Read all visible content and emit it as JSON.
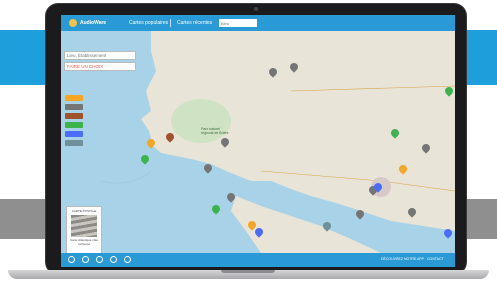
{
  "header": {
    "brand": "AudioWare",
    "nav_popular": "Cartes populaires",
    "nav_recent": "Cartes récentes",
    "search_placeholder": "Bleu"
  },
  "map_panel": {
    "search_placeholder": "Lieu, Établissement",
    "select_label": "FAIRE UN CHOIX"
  },
  "map_labels": {
    "park": "Parc naturel régional de Brière"
  },
  "legend": {
    "title": "CARTE POSTALE",
    "caption": "Carte Atlantique côte rocheuse"
  },
  "footer": {
    "link_1": "DÉCOUVREZ NOTRE APP",
    "link_2": "CONTACT"
  },
  "colors": {
    "accent": "#2a9ad6",
    "band": "#1e9fdc",
    "pin_gray": "#757575",
    "pin_orange": "#f5a623",
    "pin_green": "#3cb44b",
    "pin_brown": "#a0522d",
    "pin_blue": "#4a6cf7"
  }
}
